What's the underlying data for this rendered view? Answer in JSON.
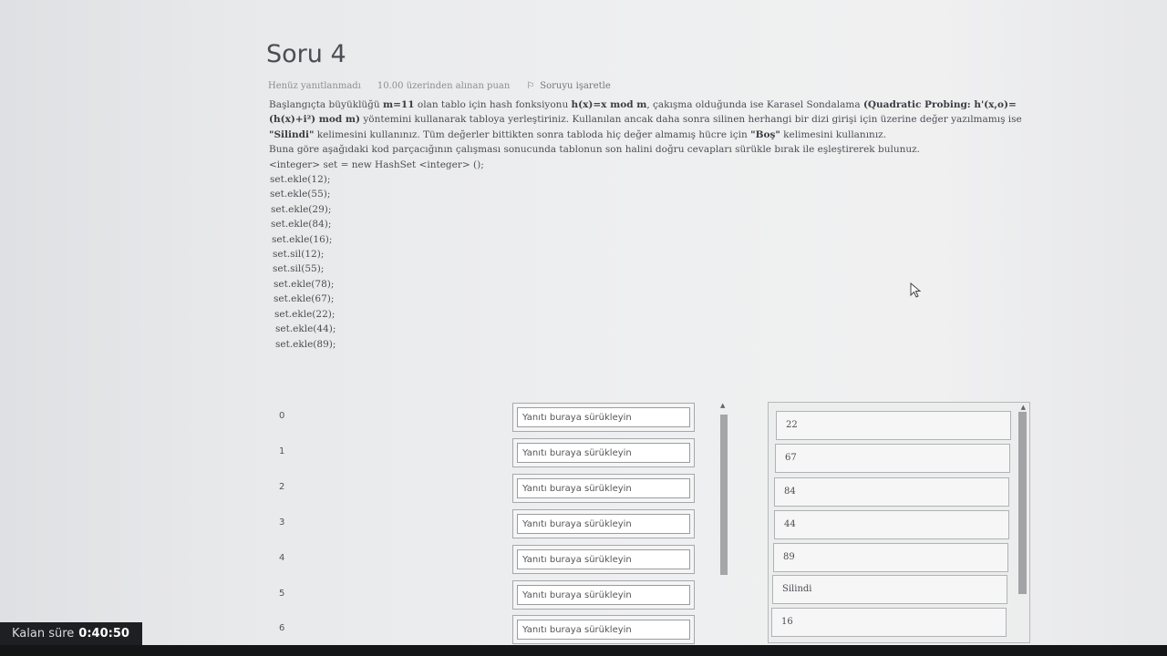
{
  "question": {
    "title": "Soru 4",
    "status": "Henüz yanıtlanmadı",
    "points": "10.00 üzerinden alınan puan",
    "flag_label": "Soruyu işaretle",
    "text_part1": "Başlangıçta büyüklüğü ",
    "m_value": "m=11",
    "text_part2": " olan tablo için hash fonksiyonu ",
    "hash_func": "h(x)=x mod m",
    "text_part3": ", çakışma olduğunda ise Karasel Sondalama ",
    "probing": "(Quadratic Probing: h'(x,o)=(h(x)+i²) mod m)",
    "text_part4": " yöntemini kullanarak tabloya yerleştiriniz. Kullanılan ancak daha sonra silinen herhangi bir dizi girişi için üzerine değer yazılmamış ise ",
    "silindi_word": "\"Silindi\"",
    "text_part5": " kelimesini kullanınız. Tüm değerler bittikten sonra tabloda hiç değer almamış hücre için ",
    "bos_word": "\"Boş\"",
    "text_part6": " kelimesini kullanınız.",
    "instruction": "Buna göre aşağıdaki kod parçacığının çalışması sonucunda tablonun son halini doğru cevapları sürükle bırak ile eşleştirerek bulunuz.",
    "code": [
      "<integer> set = new HashSet <integer> ();",
      "set.ekle(12);",
      "set.ekle(55);",
      "set.ekle(29);",
      "set.ekle(84);",
      "set.ekle(16);",
      "set.sil(12);",
      "set.sil(55);",
      "set.ekle(78);",
      "set.ekle(67);",
      "set.ekle(22);",
      "set.ekle(44);",
      "set.ekle(89);"
    ]
  },
  "table_rows": [
    {
      "index": "0",
      "placeholder": "Yanıtı buraya sürükleyin"
    },
    {
      "index": "1",
      "placeholder": "Yanıtı buraya sürükleyin"
    },
    {
      "index": "2",
      "placeholder": "Yanıtı buraya sürükleyin"
    },
    {
      "index": "3",
      "placeholder": "Yanıtı buraya sürükleyin"
    },
    {
      "index": "4",
      "placeholder": "Yanıtı buraya sürükleyin"
    },
    {
      "index": "5",
      "placeholder": "Yanıtı buraya sürükleyin"
    },
    {
      "index": "6",
      "placeholder": "Yanıtı buraya sürükleyin"
    }
  ],
  "answers": [
    "22",
    "67",
    "84",
    "44",
    "89",
    "Silindi",
    "16"
  ],
  "timer": {
    "label": "Kalan süre",
    "value": "0:40:50"
  },
  "icons": {
    "flag": "flag-icon",
    "cursor": "mouse-pointer-icon"
  }
}
